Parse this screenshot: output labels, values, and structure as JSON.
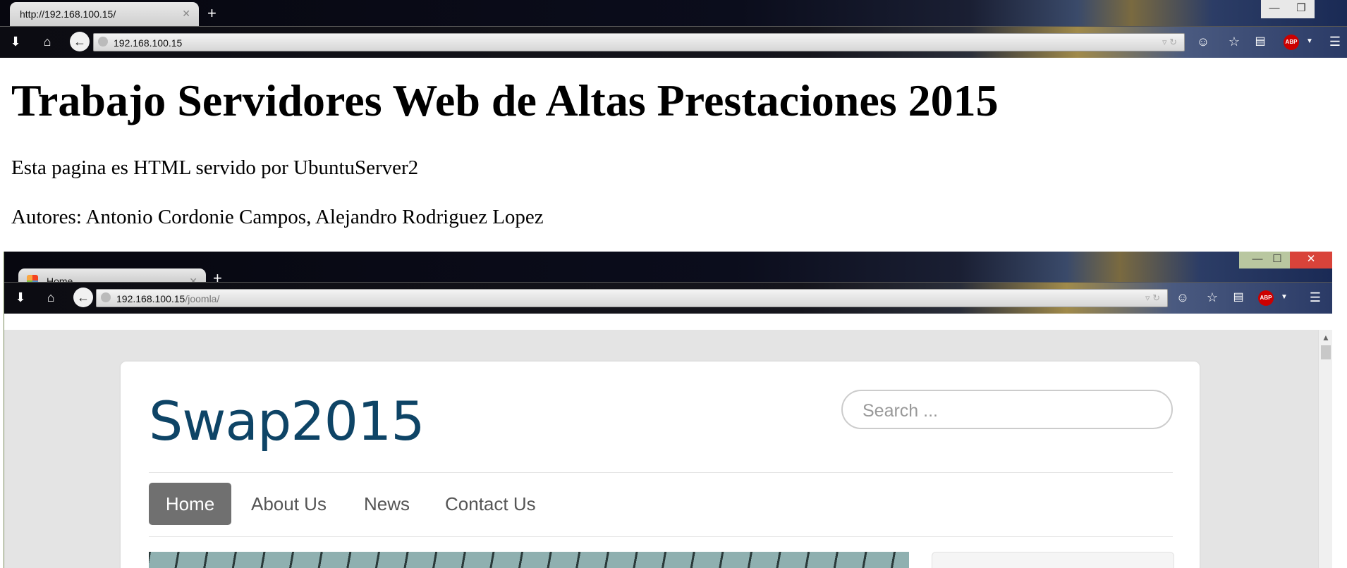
{
  "outer_browser": {
    "tab": {
      "title": "http://192.168.100.15/",
      "close": "✕"
    },
    "new_tab": "+",
    "window_controls": {
      "minimize": "—",
      "restore": "❐"
    },
    "url": "192.168.100.15"
  },
  "page": {
    "heading": "Trabajo Servidores Web de Altas Prestaciones 2015",
    "paragraph1": "Esta pagina es HTML servido por UbuntuServer2",
    "paragraph2": "Autores: Antonio Cordonie Campos, Alejandro Rodriguez Lopez"
  },
  "inner_browser": {
    "tab": {
      "title": "Home",
      "close": "✕"
    },
    "new_tab": "+",
    "window_controls": {
      "minimize": "—",
      "maximize": "☐",
      "close": "✕"
    },
    "url_host": "192.168.100.15",
    "url_path": "/joomla/"
  },
  "site": {
    "brand": "Swap2015",
    "search_placeholder": "Search ...",
    "nav": [
      {
        "label": "Home",
        "active": true
      },
      {
        "label": "About Us",
        "active": false
      },
      {
        "label": "News",
        "active": false
      },
      {
        "label": "Contact Us",
        "active": false
      }
    ]
  },
  "icons": {
    "download": "download-icon",
    "home": "home-icon",
    "back": "back-arrow-icon",
    "chat": "chat-icon",
    "star": "star-icon",
    "reader": "reader-icon",
    "adblock": "abp-icon",
    "menu": "menu-icon"
  },
  "colors": {
    "brand": "#0e4466",
    "nav_active": "#707070",
    "abp": "#cc0000",
    "inner_close": "#d9433a"
  }
}
